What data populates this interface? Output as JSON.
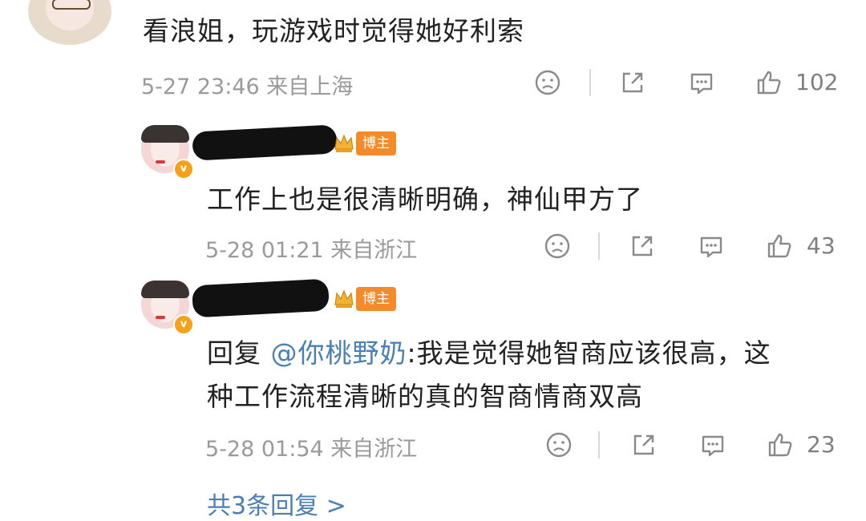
{
  "comment": {
    "text": "看浪姐，玩游戏时觉得她好利索",
    "meta": "5-27 23:46 来自上海",
    "likes": "102"
  },
  "replies": [
    {
      "badge": "博主",
      "text": "工作上也是很清晰明确，神仙甲方了",
      "meta": "5-28 01:21 来自浙江",
      "likes": "43"
    },
    {
      "badge": "博主",
      "prefix": "回复 ",
      "mention": "@你桃野奶",
      "text1": ":我是觉得她智商应该很高，这",
      "text2": "种工作流程清晰的真的智商情商双高",
      "meta": "5-28 01:54 来自浙江",
      "likes": "23"
    }
  ],
  "more_replies": "共3条回复 >",
  "colors": {
    "accent": "#4a7fb5",
    "badge": "#f48b2a",
    "meta": "#9a9a9a"
  }
}
